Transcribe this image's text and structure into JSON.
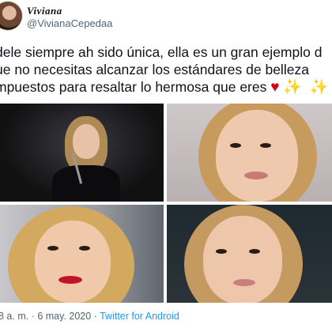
{
  "tweet": {
    "display_name": "Viviana",
    "handle": "@VivianaCepedaa",
    "lines": [
      "dele siempre ah sido única, ella es un gran ejemplo d",
      "ue no necesitas alcanzar los estándares de belleza",
      "mpuestos para resaltar lo hermosa que eres"
    ],
    "emojis": [
      "♥",
      "✨",
      "✨"
    ],
    "time": "8 a. m.",
    "separator": " · ",
    "date": "6 may. 2020",
    "app_separator": " · ",
    "app": "Twitter for Android"
  },
  "media": {
    "images": [
      "photo-on-stage",
      "photo-closeup-1",
      "photo-closeup-2",
      "photo-closeup-3"
    ]
  },
  "colors": {
    "text": "#0f1419",
    "secondary": "#536471",
    "link": "#1d9bf0",
    "heart": "#d0021b",
    "sparkle": "#f5c518"
  }
}
